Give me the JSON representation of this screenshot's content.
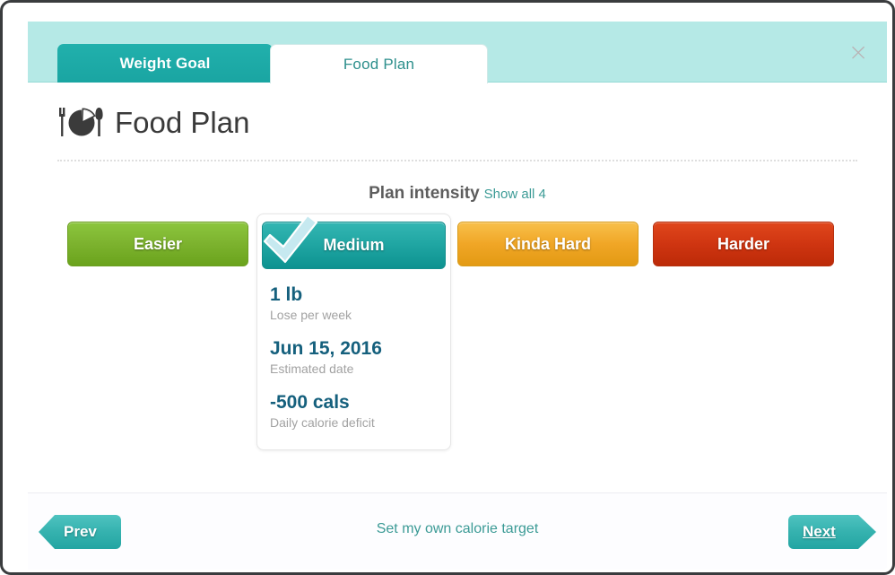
{
  "window": {
    "close_label": "×"
  },
  "tabs": [
    {
      "label": "Weight Goal",
      "active": false
    },
    {
      "label": "Food Plan",
      "active": true
    }
  ],
  "page": {
    "title": "Food Plan",
    "icon": "fork-plate-knife-icon"
  },
  "intensity": {
    "heading": "Plan intensity",
    "show_all_label": "Show all 4",
    "options": [
      {
        "label": "Easier",
        "color": "#7db32f",
        "selected": false
      },
      {
        "label": "Medium",
        "color": "#1fa5a2",
        "selected": true
      },
      {
        "label": "Kinda Hard",
        "color": "#f0a626",
        "selected": false
      },
      {
        "label": "Harder",
        "color": "#cf3511",
        "selected": false
      }
    ]
  },
  "plan_card": {
    "stats": [
      {
        "value": "1 lb",
        "label": "Lose per week"
      },
      {
        "value": "Jun 15, 2016",
        "label": "Estimated date"
      },
      {
        "value": "-500 cals",
        "label": "Daily calorie deficit"
      }
    ],
    "value_color": "#15607d"
  },
  "footer": {
    "prev_label": "Prev",
    "next_label": "Next",
    "calorie_link_label": "Set my own calorie target",
    "link_color": "#3c9b96"
  }
}
